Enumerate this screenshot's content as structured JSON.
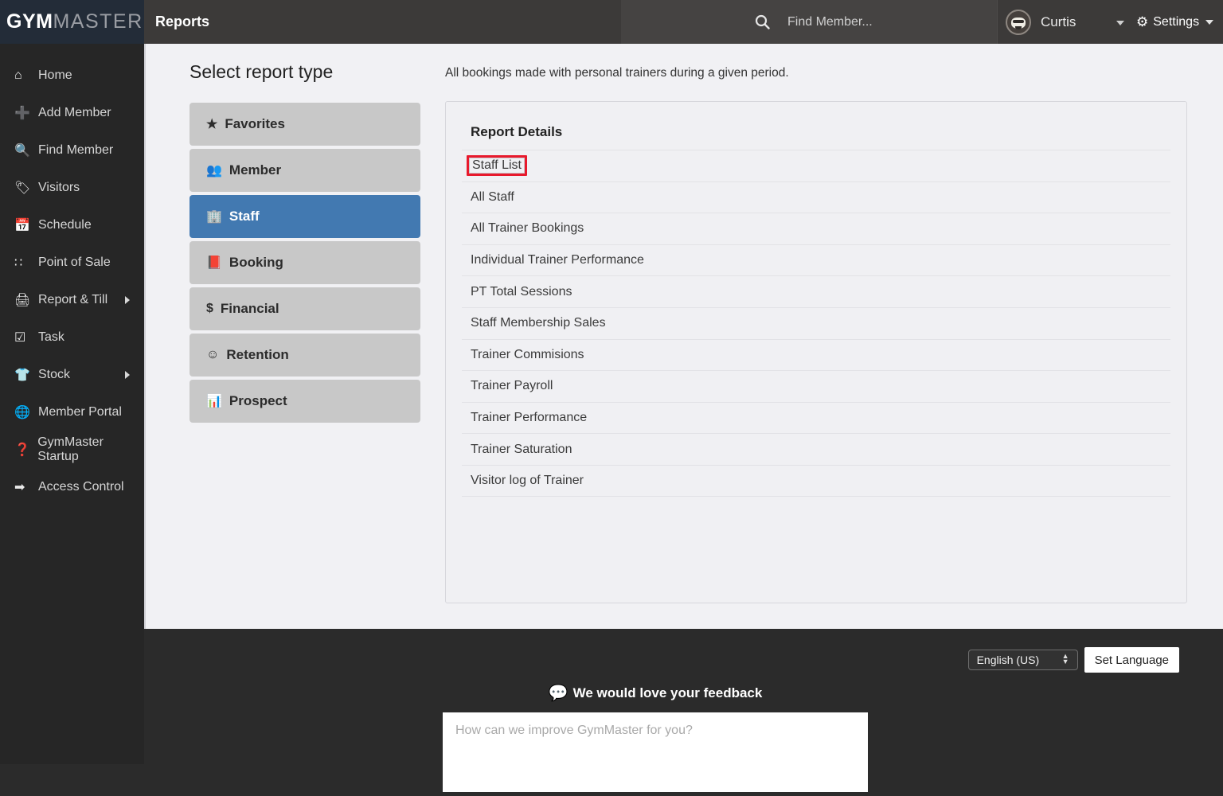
{
  "header": {
    "logo_bold": "GYM",
    "logo_light": "MASTER",
    "page_title": "Reports",
    "search_placeholder": "Find Member...",
    "search_value": "",
    "search_icon": "search-icon",
    "user_name": "Curtis",
    "settings_label": "Settings",
    "settings_icon": "gear-icon",
    "avatar_icon": "avatar"
  },
  "sidebar": {
    "items": [
      {
        "label": "Home",
        "icon": "home-icon",
        "has_submenu": false
      },
      {
        "label": "Add Member",
        "icon": "plus-icon",
        "has_submenu": false
      },
      {
        "label": "Find Member",
        "icon": "search-icon",
        "has_submenu": false
      },
      {
        "label": "Visitors",
        "icon": "tag-icon",
        "has_submenu": false
      },
      {
        "label": "Schedule",
        "icon": "calendar-icon",
        "has_submenu": false
      },
      {
        "label": "Point of Sale",
        "icon": "grid-icon",
        "has_submenu": false
      },
      {
        "label": "Report & Till",
        "icon": "printer-icon",
        "has_submenu": true
      },
      {
        "label": "Task",
        "icon": "checkbox-icon",
        "has_submenu": false
      },
      {
        "label": "Stock",
        "icon": "shirt-icon",
        "has_submenu": true
      },
      {
        "label": "Member Portal",
        "icon": "globe-icon",
        "has_submenu": false
      },
      {
        "label": "GymMaster Startup",
        "icon": "question-icon",
        "has_submenu": false
      },
      {
        "label": "Access Control",
        "icon": "logout-icon",
        "has_submenu": false
      }
    ]
  },
  "main": {
    "select_report_title": "Select report type",
    "report_description": "All bookings made with personal trainers during a given period.",
    "report_types": [
      {
        "label": "Favorites",
        "icon": "star-icon",
        "active": false
      },
      {
        "label": "Member",
        "icon": "users-icon",
        "active": false
      },
      {
        "label": "Staff",
        "icon": "building-icon",
        "active": true
      },
      {
        "label": "Booking",
        "icon": "book-icon",
        "active": false
      },
      {
        "label": "Financial",
        "icon": "dollar-icon",
        "active": false
      },
      {
        "label": "Retention",
        "icon": "smiley-icon",
        "active": false
      },
      {
        "label": "Prospect",
        "icon": "bar-chart-icon",
        "active": false
      }
    ],
    "details_title": "Report Details",
    "details": [
      {
        "label": "Staff List",
        "highlighted": true
      },
      {
        "label": "All Staff",
        "highlighted": false
      },
      {
        "label": "All Trainer Bookings",
        "highlighted": false
      },
      {
        "label": "Individual Trainer Performance",
        "highlighted": false
      },
      {
        "label": "PT Total Sessions",
        "highlighted": false
      },
      {
        "label": "Staff Membership Sales",
        "highlighted": false
      },
      {
        "label": "Trainer Commisions",
        "highlighted": false
      },
      {
        "label": "Trainer Payroll",
        "highlighted": false
      },
      {
        "label": "Trainer Performance",
        "highlighted": false
      },
      {
        "label": "Trainer Saturation",
        "highlighted": false
      },
      {
        "label": "Visitor log of Trainer",
        "highlighted": false
      }
    ]
  },
  "footer": {
    "language_selected": "English (US)",
    "set_language_label": "Set Language",
    "feedback_title": "We would love your feedback",
    "feedback_icon": "chat-bubble-icon",
    "feedback_placeholder": "How can we improve GymMaster for you?",
    "feedback_value": ""
  },
  "colors": {
    "accent_blue": "#4279b1",
    "highlight_red": "#e8192c",
    "sidebar_bg": "#262626",
    "logo_bg": "#232c38",
    "topbar_bg": "#3c3a39",
    "content_bg": "#f1f1f4",
    "button_gray": "#c8c8c8"
  }
}
